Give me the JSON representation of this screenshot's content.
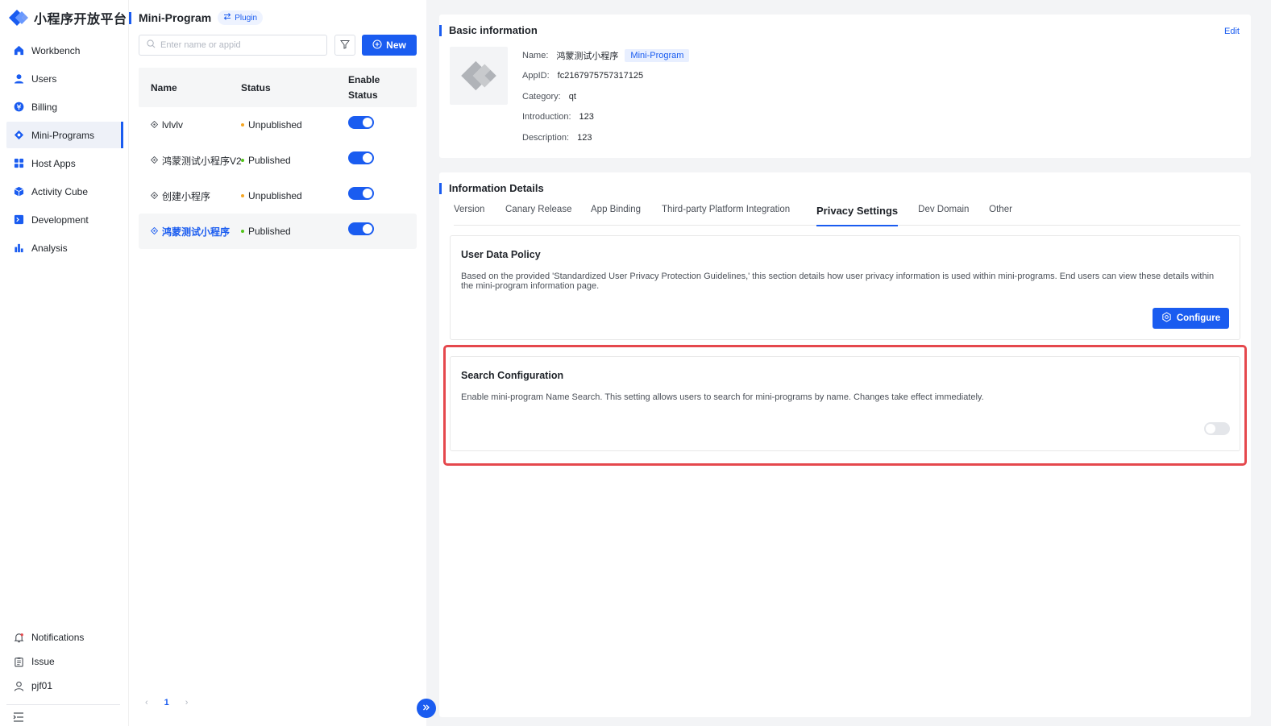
{
  "brand": {
    "title": "小程序开放平台",
    "accent": "#1a5cf0"
  },
  "sidebar": {
    "items": [
      {
        "label": "Workbench",
        "icon": "home-icon"
      },
      {
        "label": "Users",
        "icon": "user-icon"
      },
      {
        "label": "Billing",
        "icon": "billing-icon"
      },
      {
        "label": "Mini-Programs",
        "icon": "mini-program-icon",
        "active": true
      },
      {
        "label": "Host Apps",
        "icon": "grid-icon"
      },
      {
        "label": "Activity Cube",
        "icon": "cube-icon"
      },
      {
        "label": "Development",
        "icon": "terminal-icon"
      },
      {
        "label": "Analysis",
        "icon": "bar-chart-icon"
      }
    ],
    "bottom": [
      {
        "label": "Notifications",
        "icon": "bell-icon"
      },
      {
        "label": "Issue",
        "icon": "clipboard-icon"
      },
      {
        "label": "pjf01",
        "icon": "user-outline-icon"
      }
    ]
  },
  "list_panel": {
    "title": "Mini-Program",
    "plugin_tag": "Plugin",
    "search_placeholder": "Enter name or appid",
    "new_label": "New",
    "columns": {
      "name": "Name",
      "status": "Status",
      "enable_line1": "Enable",
      "enable_line2": "Status"
    },
    "rows": [
      {
        "name": "lvlvlv",
        "status": "Unpublished",
        "status_color": "#f5a623",
        "enabled": true
      },
      {
        "name": "鸿蒙测试小程序V2",
        "status": "Published",
        "status_color": "#52c41a",
        "enabled": true
      },
      {
        "name": "创建小程序",
        "status": "Unpublished",
        "status_color": "#f5a623",
        "enabled": true
      },
      {
        "name": "鸿蒙测试小程序",
        "status": "Published",
        "status_color": "#52c41a",
        "enabled": true,
        "selected": true
      }
    ],
    "pagination": {
      "current": "1"
    }
  },
  "basic": {
    "title": "Basic information",
    "edit_label": "Edit",
    "name_label": "Name:",
    "name_value": "鸿蒙测试小程序",
    "type_tag": "Mini-Program",
    "appid_label": "AppID:",
    "appid_value": "fc2167975757317125",
    "category_label": "Category:",
    "category_value": "qt",
    "intro_label": "Introduction:",
    "intro_value": "123",
    "desc_label": "Description:",
    "desc_value": "123"
  },
  "details": {
    "title": "Information Details",
    "tabs": [
      {
        "label": "Version"
      },
      {
        "label": "Canary Release"
      },
      {
        "label": "App Binding"
      },
      {
        "label": "Third-party Platform Integration"
      },
      {
        "label": "Privacy Settings",
        "active": true
      },
      {
        "label": "Dev Domain"
      },
      {
        "label": "Other"
      }
    ],
    "policy": {
      "title": "User Data Policy",
      "desc": "Based on the provided 'Standardized User Privacy Protection Guidelines,' this section details how user privacy information is used within mini-programs. End users can view these details within the mini-program information page.",
      "configure_label": "Configure"
    },
    "search_config": {
      "title": "Search Configuration",
      "desc": "Enable mini-program Name Search. This setting allows users to search for mini-programs by name. Changes take effect immediately.",
      "enabled": false
    }
  },
  "colors": {
    "published": "#52c41a",
    "unpublished": "#f5a623",
    "highlight": "#e5484d"
  }
}
